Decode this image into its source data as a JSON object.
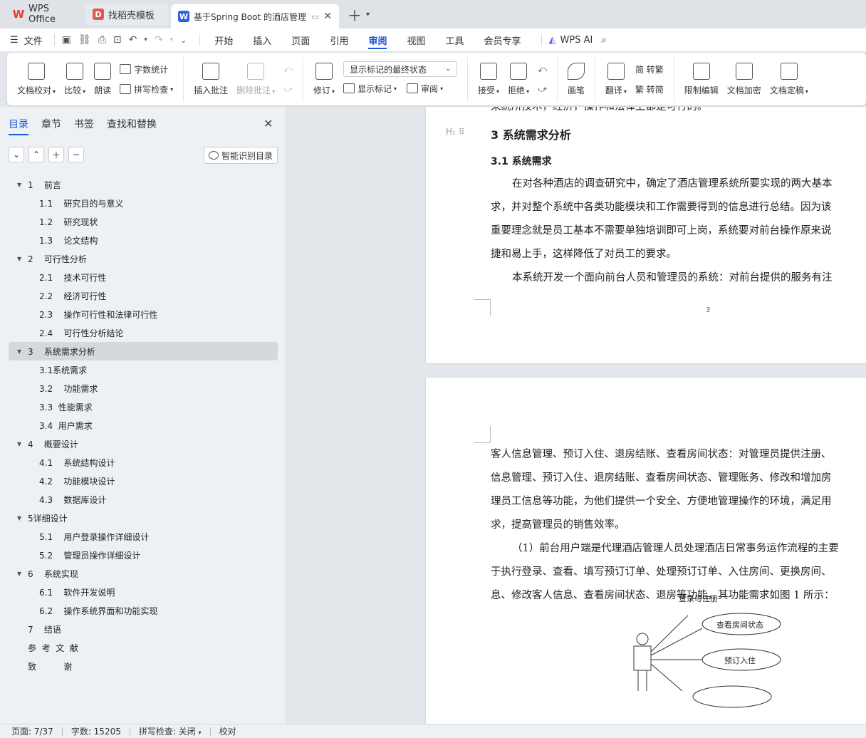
{
  "tabs": [
    {
      "label": "WPS Office",
      "icon": "wps-logo-icon",
      "color": "#e43b2f"
    },
    {
      "label": "找稻壳模板",
      "icon": "docer-icon",
      "color": "#e05a4f"
    },
    {
      "label": "基于Spring Boot 的酒店管理",
      "icon": "writer-doc-icon",
      "color": "#2b62e3"
    }
  ],
  "menu": {
    "file": "文件",
    "items": [
      "开始",
      "插入",
      "页面",
      "引用",
      "审阅",
      "视图",
      "工具",
      "会员专享"
    ],
    "active": "审阅",
    "ai": "WPS AI"
  },
  "ribbon": {
    "proofread": "文档校对",
    "compare": "比较",
    "read_aloud": "朗读",
    "word_count": "字数统计",
    "spell_check": "拼写检查",
    "insert_comment": "插入批注",
    "delete_comment": "删除批注",
    "revise": "修订",
    "display_select": "显示标记的最终状态",
    "show_marks": "显示标记",
    "review": "审阅",
    "accept": "接受",
    "reject": "拒绝",
    "pen": "画笔",
    "translate": "翻译",
    "to_traditional": "简 转繁",
    "to_simplified": "繁 转简",
    "restrict_edit": "限制编辑",
    "encrypt": "文档加密",
    "finalize": "文档定稿"
  },
  "panel": {
    "tabs": [
      "目录",
      "章节",
      "书签",
      "查找和替换"
    ],
    "smart_toc": "智能识别目录",
    "toc": [
      {
        "text": "1    前言",
        "level": 1,
        "expand": true
      },
      {
        "text": "1.1    研究目的与意义",
        "level": 2
      },
      {
        "text": "1.2    研究现状",
        "level": 2
      },
      {
        "text": "1.3    论文结构",
        "level": 2
      },
      {
        "text": "2    可行性分析",
        "level": 1,
        "expand": true
      },
      {
        "text": "2.1    技术可行性",
        "level": 2
      },
      {
        "text": "2.2    经济可行性",
        "level": 2
      },
      {
        "text": "2.3    操作可行性和法律可行性",
        "level": 2
      },
      {
        "text": "2.4    可行性分析结论",
        "level": 2
      },
      {
        "text": "3    系统需求分析",
        "level": 1,
        "expand": true,
        "selected": true
      },
      {
        "text": "3.1系统需求",
        "level": 2
      },
      {
        "text": "3.2    功能需求",
        "level": 2
      },
      {
        "text": "3.3  性能需求",
        "level": 2
      },
      {
        "text": "3.4  用户需求",
        "level": 2
      },
      {
        "text": "4    概要设计",
        "level": 1,
        "expand": true
      },
      {
        "text": "4.1    系统结构设计",
        "level": 2
      },
      {
        "text": "4.2    功能模块设计",
        "level": 2
      },
      {
        "text": "4.3    数据库设计",
        "level": 2
      },
      {
        "text": "5详细设计",
        "level": 1,
        "expand": true
      },
      {
        "text": "5.1    用户登录操作详细设计",
        "level": 2
      },
      {
        "text": "5.2    管理员操作详细设计",
        "level": 2
      },
      {
        "text": "6    系统实现",
        "level": 1,
        "expand": true
      },
      {
        "text": "6.1    软件开发说明",
        "level": 2
      },
      {
        "text": "6.2    操作系统界面和功能实现",
        "level": 2
      },
      {
        "text": "7    结语",
        "level": 1,
        "expand": false
      },
      {
        "text": "参  考  文  献",
        "level": 1,
        "expand": false
      },
      {
        "text": "致          谢",
        "level": 1,
        "expand": false
      }
    ]
  },
  "doc": {
    "page1": {
      "top_cut": "采统所技术，经济，操作和法律上都是可行的。",
      "h1": "3    系统需求分析",
      "h2": "3.1  系统需求",
      "lines": [
        "在对各种酒店的调查研究中，确定了酒店管理系统所要实现的两大基本",
        "求，并对整个系统中各类功能模块和工作需要得到的信息进行总结。因为该",
        "重要理念就是员工基本不需要单独培训即可上岗，系统要对前台操作原来说",
        "捷和易上手，这样降低了对员工的要求。",
        "本系统开发一个面向前台人员和管理员的系统：对前台提供的服务有注"
      ],
      "page_number": "3"
    },
    "page2": {
      "lines": [
        "客人信息管理、预订入住、退房结账、查看房间状态：对管理员提供注册、",
        "信息管理、预订入住、退房结账、查看房间状态、管理账务、修改和增加房",
        "理员工信息等功能，为他们提供一个安全、方便地管理操作的环境，满足用",
        "求，提高管理员的销售效率。",
        "（1）前台用户端是代理酒店管理人员处理酒店日常事务运作流程的主要",
        "于执行登录、查看、填写预订订单、处理预订订单、入住房间、更换房间、",
        "息、修改客人信息、查看房间状态、退房等功能，其功能需求如图 1 所示："
      ],
      "diagram": [
        "登录与注册",
        "查看房间状态",
        "预订入住"
      ]
    }
  },
  "status": {
    "page": "页面: 7/37",
    "words": "字数: 15205",
    "spell": "拼写检查: 关闭",
    "proof": "校对"
  }
}
